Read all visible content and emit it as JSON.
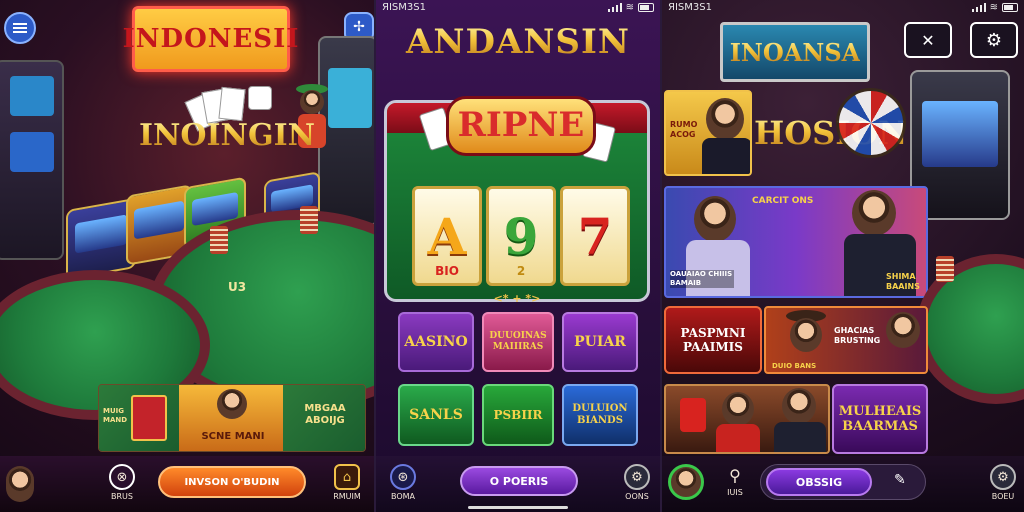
{
  "panel1": {
    "sign_text": "INDONESII",
    "logo_text": "INOINGIN",
    "table_label": "U3",
    "banner": {
      "left_text": "MUIG MAND",
      "center_text": "SCNE MANI",
      "right_text": "MBGAA ABOIJG"
    },
    "bottom_nav": {
      "profile_label": "",
      "casino_label": "BRUS",
      "action_button": "INVSON O'BUDIN",
      "right_label": "RMUIM"
    },
    "icons": {
      "menu": "menu-icon",
      "tools": "tools-icon",
      "home": "home-icon"
    }
  },
  "panel2": {
    "status": {
      "time": "ЯISM3S1",
      "signal": "signal-icon",
      "wifi": "wifi-icon",
      "battery": "battery-icon"
    },
    "title": "ANDANSIN",
    "header_logo": "RIPNE",
    "reels": [
      "A",
      "9",
      "7"
    ],
    "reel_sublabels": [
      "BIO",
      "2",
      ""
    ],
    "reel_footer": "<* + *>",
    "tiles": [
      {
        "label": "AASINO",
        "color": "#6a2a9a"
      },
      {
        "label": "DUUOINAS MAIIIRAS",
        "color": "#c23a73"
      },
      {
        "label": "PUIAR",
        "color": "#7a2ca0"
      },
      {
        "label": "SANLS",
        "color": "#1b8d3a"
      },
      {
        "label": "PSBIIR",
        "color": "#1a8f33"
      },
      {
        "label": "DULUION BIANDS",
        "color": "#2050b4"
      }
    ],
    "bottom_nav": {
      "left_label": "BOMA",
      "center_button": "O POERIS",
      "right_label": "OONS"
    }
  },
  "panel3": {
    "status": {
      "time": "ЯISM3S1",
      "signal": "signal-icon",
      "wifi": "wifi-icon",
      "battery": "battery-icon"
    },
    "sign_text": "INOANSA",
    "logo_text": "HOSION",
    "top_buttons": {
      "left": "close-icon",
      "right": "settings-icon"
    },
    "cards": [
      {
        "top_text": "RUMO ACOG",
        "bottom_text": ""
      },
      {
        "top_text": "CARCIT ONS",
        "bottom_text": ""
      },
      {
        "left_text": "OAUAIAO CHIIIS BAMAIB",
        "right_text": "SHIMA BAAINS"
      },
      {
        "title": "PASPMNI PAAIMIS"
      },
      {
        "caption": "DUIO BANS",
        "right_text": "GHACIAS BRUSTING"
      },
      {
        "title": "MULHEAIS BAARMAS"
      }
    ],
    "bottom_nav": {
      "search_label": "IUIS",
      "center_button": "OBSSIG",
      "right_label": "BOEU"
    }
  }
}
